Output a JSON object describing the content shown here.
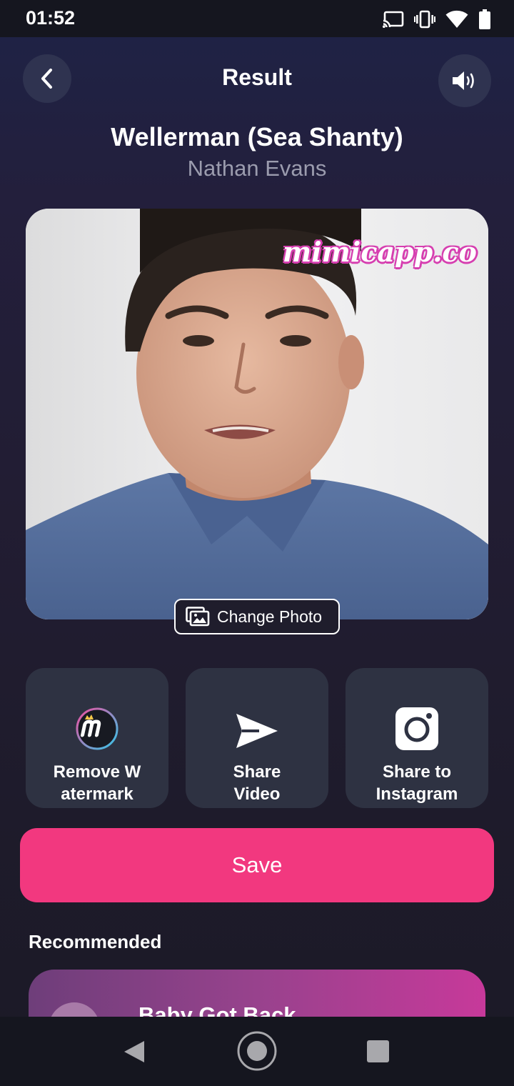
{
  "status_bar": {
    "time": "01:52",
    "icons": [
      "cast-icon",
      "vibrate-icon",
      "wifi-icon",
      "battery-icon"
    ]
  },
  "header": {
    "title": "Result",
    "back_icon": "chevron-left-icon",
    "sound_icon": "speaker-icon"
  },
  "song": {
    "title": "Wellerman (Sea Shanty)",
    "artist": "Nathan Evans"
  },
  "preview": {
    "watermark": "mimicapp.co",
    "change_photo_label": "Change Photo",
    "change_photo_icon": "image-gallery-icon"
  },
  "actions": [
    {
      "label": "Remove W\natermark",
      "icon": "mimic-logo-icon"
    },
    {
      "label": "Share\nVideo",
      "icon": "send-icon"
    },
    {
      "label": "Share to\nInstagram",
      "icon": "instagram-icon"
    }
  ],
  "save_label": "Save",
  "recommended": {
    "heading": "Recommended",
    "items": [
      {
        "title": "Baby Got Back"
      }
    ]
  },
  "colors": {
    "accent": "#f2387f",
    "card_bg": "#2e3242",
    "recommended_gradient_start": "#6e3e7a",
    "recommended_gradient_end": "#c7399a"
  },
  "nav_bar": {
    "buttons": [
      "back-triangle-icon",
      "home-circle-icon",
      "recents-square-icon"
    ]
  }
}
